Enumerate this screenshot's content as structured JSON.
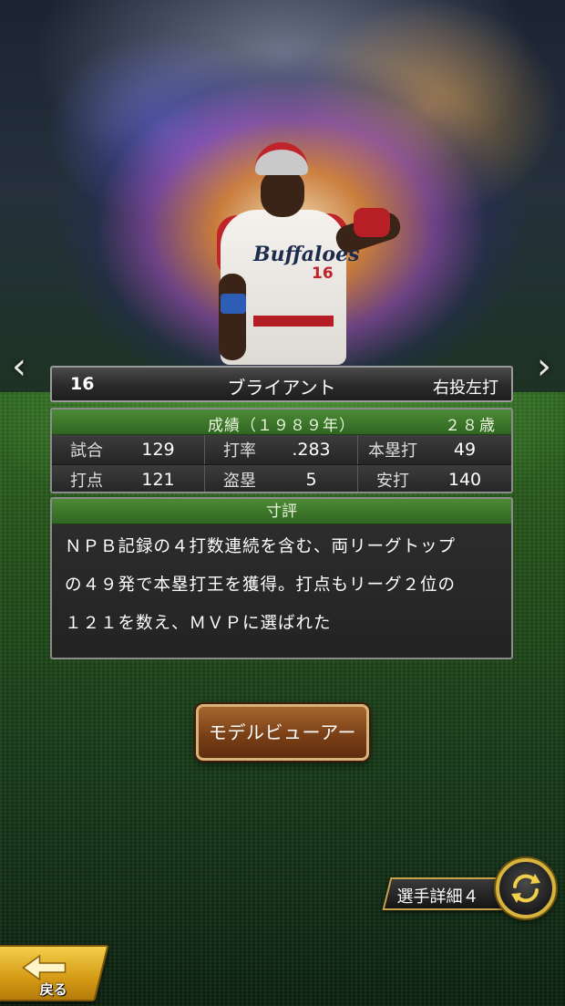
{
  "player": {
    "uniform_number": "16",
    "name": "ブライアント",
    "throw_bat": "右投左打"
  },
  "stats": {
    "header_title": "成績（１９８９年）",
    "age": "２８歳",
    "rows": [
      [
        {
          "label": "試合",
          "value": "129"
        },
        {
          "label": "打率",
          "value": ".283"
        },
        {
          "label": "本塁打",
          "value": "49"
        }
      ],
      [
        {
          "label": "打点",
          "value": "121"
        },
        {
          "label": "盗塁",
          "value": "5"
        },
        {
          "label": "安打",
          "value": "140"
        }
      ]
    ]
  },
  "comment": {
    "header": "寸評",
    "lines": [
      "ＮＰＢ記録の４打数連続を含む、両リーグトップ",
      "の４９発で本塁打王を獲得。打点もリーグ２位の",
      "１２１を数え、ＭＶＰに選ばれた"
    ]
  },
  "buttons": {
    "model_viewer": "モデルビューアー",
    "player_detail": "選手詳細４",
    "back": "戻る"
  },
  "nav": {
    "prev_glyph": "‹",
    "next_glyph": "›"
  },
  "icons": {
    "swap": "swap-icon",
    "back_arrow": "back-arrow-icon"
  },
  "colors": {
    "section_header_green": "#3f7a2c",
    "button_brown": "#7a4017",
    "gold_accent": "#d8b43e"
  }
}
